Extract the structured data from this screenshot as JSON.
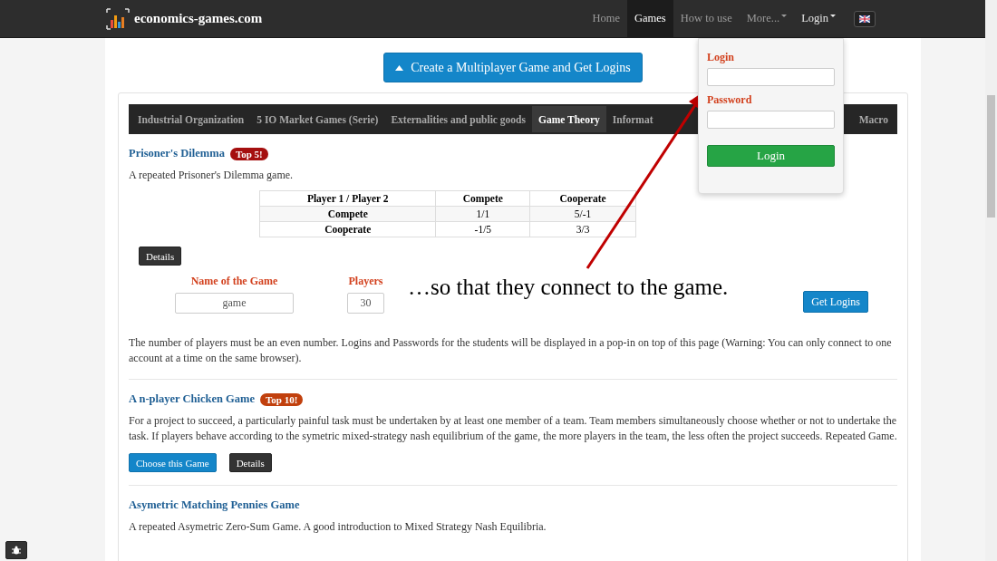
{
  "nav": {
    "brand": "economics-games.com",
    "links": [
      {
        "label": "Home",
        "selected": false,
        "dropdown": false
      },
      {
        "label": "Games",
        "selected": true,
        "dropdown": false
      },
      {
        "label": "How to use",
        "selected": false,
        "dropdown": false
      },
      {
        "label": "More...",
        "selected": false,
        "dropdown": true
      },
      {
        "label": "Login",
        "selected": false,
        "dropdown": true,
        "open": true
      }
    ]
  },
  "login_popup": {
    "fields": [
      {
        "label": "Login"
      },
      {
        "label": "Password"
      }
    ],
    "button": "Login"
  },
  "create_button": "Create a Multiplayer Game and Get Logins",
  "tabs": [
    {
      "label": "Industrial Organization",
      "selected": false
    },
    {
      "label": "5 IO Market Games (Serie)",
      "selected": false
    },
    {
      "label": "Externalities and public goods",
      "selected": false
    },
    {
      "label": "Game Theory",
      "selected": true
    },
    {
      "label": "Informat",
      "selected": false
    },
    {
      "label": "Macro",
      "selected": false
    }
  ],
  "games": [
    {
      "title": "Prisoner's Dilemma",
      "badge": {
        "text": "Top 5!",
        "color": "#a50f0f"
      },
      "description": "A repeated Prisoner's Dilemma game.",
      "payoff_table": {
        "columns": [
          "Player 1 / Player 2",
          "Compete",
          "Cooperate"
        ],
        "rows": [
          [
            "Compete",
            "1/1",
            "5/-1"
          ],
          [
            "Cooperate",
            "-1/5",
            "3/3"
          ]
        ]
      },
      "buttons": [
        {
          "label": "Details",
          "kind": "dark"
        }
      ],
      "form": {
        "name_label": "Name of the Game",
        "name_value": "game",
        "players_label": "Players",
        "players_value": "30",
        "submit": "Get Logins"
      },
      "note": "The number of players must be an even number. Logins and Passwords for the students will be displayed in a pop-in on top of this page (Warning: You can only connect to one account at a time on the same browser)."
    },
    {
      "title": "A n-player Chicken Game",
      "badge": {
        "text": "Top 10!",
        "color": "#c1400d"
      },
      "description": "For a project to succeed, a particularly painful task must be undertaken by at least one member of a team. Team members simultaneously choose whether or not to undertake the task. If players behave according to the symetric mixed-strategy nash equilibrium of the game, the more players in the team, the less often the project succeeds. Repeated Game.",
      "buttons": [
        {
          "label": "Choose this Game",
          "kind": "primary"
        },
        {
          "label": "Details",
          "kind": "dark"
        }
      ]
    },
    {
      "title": "Asymetric Matching Pennies Game",
      "description": "A repeated Asymetric Zero-Sum Game. A good introduction to Mixed Strategy Nash Equilibria."
    }
  ],
  "annotation": {
    "text": "…so that they connect to the game."
  }
}
